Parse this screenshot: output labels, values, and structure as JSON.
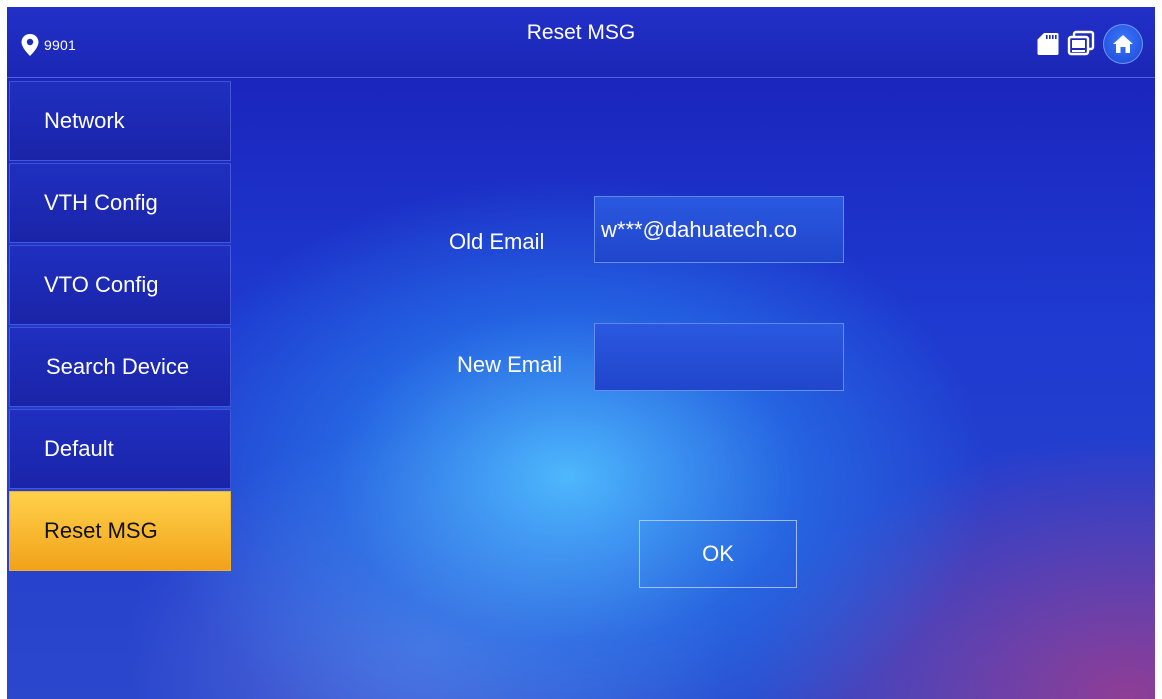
{
  "header": {
    "device_id": "9901",
    "title": "Reset MSG",
    "icons": [
      "location-pin-icon",
      "sd-card-icon",
      "monitor-icon",
      "home-icon"
    ]
  },
  "sidebar": {
    "items": [
      {
        "label": "Network",
        "active": false
      },
      {
        "label": "VTH Config",
        "active": false
      },
      {
        "label": "VTO Config",
        "active": false
      },
      {
        "label": "Search Device",
        "active": false
      },
      {
        "label": "Default",
        "active": false
      },
      {
        "label": "Reset MSG",
        "active": true
      }
    ]
  },
  "form": {
    "old_email_label": "Old Email",
    "old_email_value": "w***@dahuatech.co",
    "new_email_label": "New Email",
    "new_email_value": "",
    "ok_label": "OK"
  },
  "colors": {
    "background": "#1e3ad0",
    "active_item": "#f5b030",
    "text": "#ffffff"
  }
}
